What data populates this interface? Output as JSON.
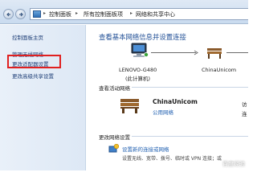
{
  "breadcrumb": {
    "items": [
      "控制面板",
      "所有控制面板项",
      "网络和共享中心"
    ],
    "separator": "▸"
  },
  "sidebar": {
    "items": [
      {
        "label": "控制面板主页",
        "highlighted": false
      },
      {
        "label": "管理无线网络",
        "highlighted": false
      },
      {
        "label": "更改适配器设置",
        "highlighted": true
      },
      {
        "label": "更改高级共享设置",
        "highlighted": false
      }
    ]
  },
  "main": {
    "title": "查看基本网络信息并设置连接",
    "map": {
      "computer_name": "LENOVO-G480",
      "computer_sub": "(此计算机)",
      "network_name": "ChinaUnicom"
    },
    "active_networks_heading": "查看活动网络",
    "active_network": {
      "name": "ChinaUnicom",
      "type": "公用网络",
      "access_truncated": "访",
      "connection_truncated": "连"
    },
    "change_settings_heading": "更改网络设置",
    "setup_link": "设置新的连接或网络",
    "setup_desc": "设置无线、宽带、拨号、临时或 VPN 连接；或"
  },
  "watermark": "百度经验",
  "colors": {
    "link": "#1f5fb0",
    "title": "#1f4e95",
    "highlight_box": "#e02020",
    "sidebar_bg": "#e3ecf7"
  }
}
